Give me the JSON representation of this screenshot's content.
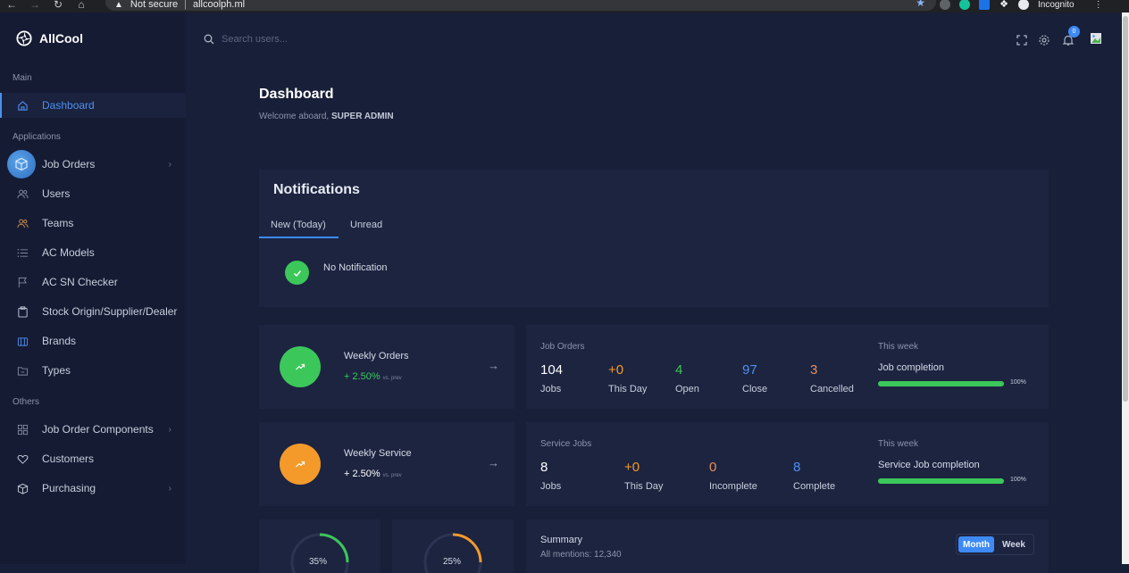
{
  "browser": {
    "security": "Not secure",
    "url": "allcoolph.ml",
    "profile": "Incognito"
  },
  "sidebar": {
    "brand": "AllCool",
    "sections": {
      "main": "Main",
      "applications": "Applications",
      "others": "Others"
    },
    "items": [
      {
        "label": "Dashboard",
        "icon": "home-icon"
      },
      {
        "label": "Job Orders",
        "icon": "box-icon"
      },
      {
        "label": "Users",
        "icon": "users-icon"
      },
      {
        "label": "Teams",
        "icon": "team-icon"
      },
      {
        "label": "AC Models",
        "icon": "list-icon"
      },
      {
        "label": "AC SN Checker",
        "icon": "flag-icon"
      },
      {
        "label": "Stock Origin/Supplier/Dealer",
        "icon": "clipboard-icon"
      },
      {
        "label": "Brands",
        "icon": "brand-icon"
      },
      {
        "label": "Types",
        "icon": "folder-icon"
      },
      {
        "label": "Job Order Components",
        "icon": "grid-icon"
      },
      {
        "label": "Customers",
        "icon": "heart-icon"
      },
      {
        "label": "Purchasing",
        "icon": "package-icon"
      }
    ]
  },
  "topbar": {
    "search_placeholder": "Search users...",
    "notification_count": "0"
  },
  "main": {
    "title": "Dashboard",
    "welcome_prefix": "Welcome aboard, ",
    "welcome_user": "SUPER ADMIN"
  },
  "notifications": {
    "title": "Notifications",
    "tabs": [
      "New (Today)",
      "Unread"
    ],
    "empty_text": "No Notification"
  },
  "weekly_orders": {
    "title": "Weekly Orders",
    "change": "+ 2.50%",
    "vs": "vs. prev"
  },
  "weekly_service": {
    "title": "Weekly Service",
    "change": "+ 2.50%",
    "vs": "vs. prev"
  },
  "job_orders": {
    "heading": "Job Orders",
    "stats": [
      {
        "value": "104",
        "label": "Jobs",
        "color": "#ffffff"
      },
      {
        "value": "+0",
        "label": "This Day",
        "color": "#f39a2b"
      },
      {
        "value": "4",
        "label": "Open",
        "color": "#3cc75a"
      },
      {
        "value": "97",
        "label": "Close",
        "color": "#4d90f0"
      },
      {
        "value": "3",
        "label": "Cancelled",
        "color": "#e8915a"
      }
    ],
    "week_label": "This week",
    "completion_title": "Job completion",
    "completion_pct": "100%",
    "completion_value": 1.0
  },
  "service_jobs": {
    "heading": "Service Jobs",
    "stats": [
      {
        "value": "8",
        "label": "Jobs",
        "color": "#ffffff"
      },
      {
        "value": "+0",
        "label": "This Day",
        "color": "#f39a2b"
      },
      {
        "value": "0",
        "label": "Incomplete",
        "color": "#e8915a"
      },
      {
        "value": "8",
        "label": "Complete",
        "color": "#4d90f0"
      }
    ],
    "week_label": "This week",
    "completion_title": "Service Job completion",
    "completion_pct": "100%",
    "completion_value": 1.0
  },
  "mini_gauges": [
    {
      "value": "35%",
      "color": "#3cc75a"
    },
    {
      "value": "25%",
      "color": "#f39a2b"
    }
  ],
  "summary": {
    "title": "Summary",
    "subtitle": "All mentions: 12,340",
    "toggle": [
      "Month",
      "Week"
    ]
  }
}
